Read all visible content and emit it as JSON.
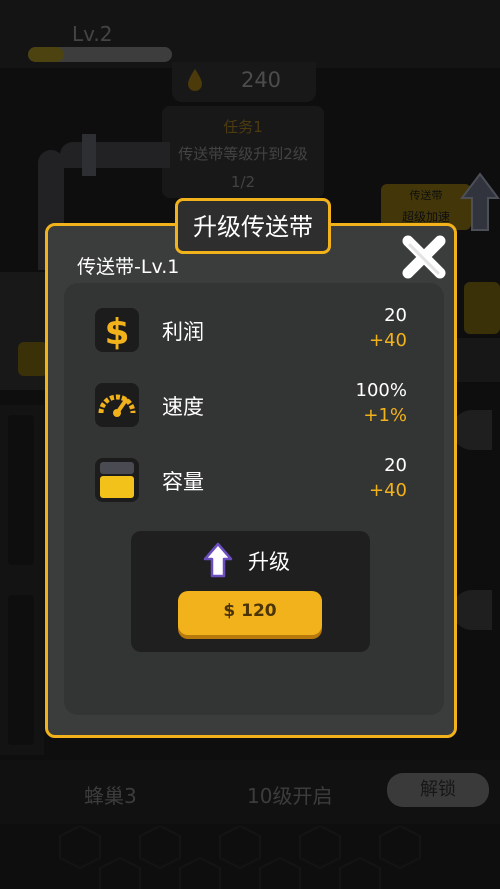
{
  "hud": {
    "level_label": "Lv.2",
    "level_progress": 0.25,
    "honey_amount": "240"
  },
  "task": {
    "title": "任务1",
    "description": "传送带等级升到2级",
    "progress": "1/2"
  },
  "boost_badge": {
    "line1": "传送带",
    "line2": "超级加速"
  },
  "bottom": {
    "hive_label": "蜂巢3",
    "unlock_level": "10级开启",
    "unlock_button": "解锁"
  },
  "modal": {
    "title": "升级传送带",
    "subtitle": "传送带-Lv.1",
    "stats": [
      {
        "label": "利润",
        "value": "20",
        "bonus": "+40",
        "icon": "dollar-icon"
      },
      {
        "label": "速度",
        "value": "100%",
        "bonus": "+1%",
        "icon": "speedometer-icon"
      },
      {
        "label": "容量",
        "value": "20",
        "bonus": "+40",
        "icon": "jar-icon"
      }
    ],
    "upgrade_label": "升级",
    "price_label": "$ 120"
  },
  "colors": {
    "accent": "#f2b21b",
    "modal_bg": "#3b3c3c",
    "background": "#1b1b1c"
  }
}
